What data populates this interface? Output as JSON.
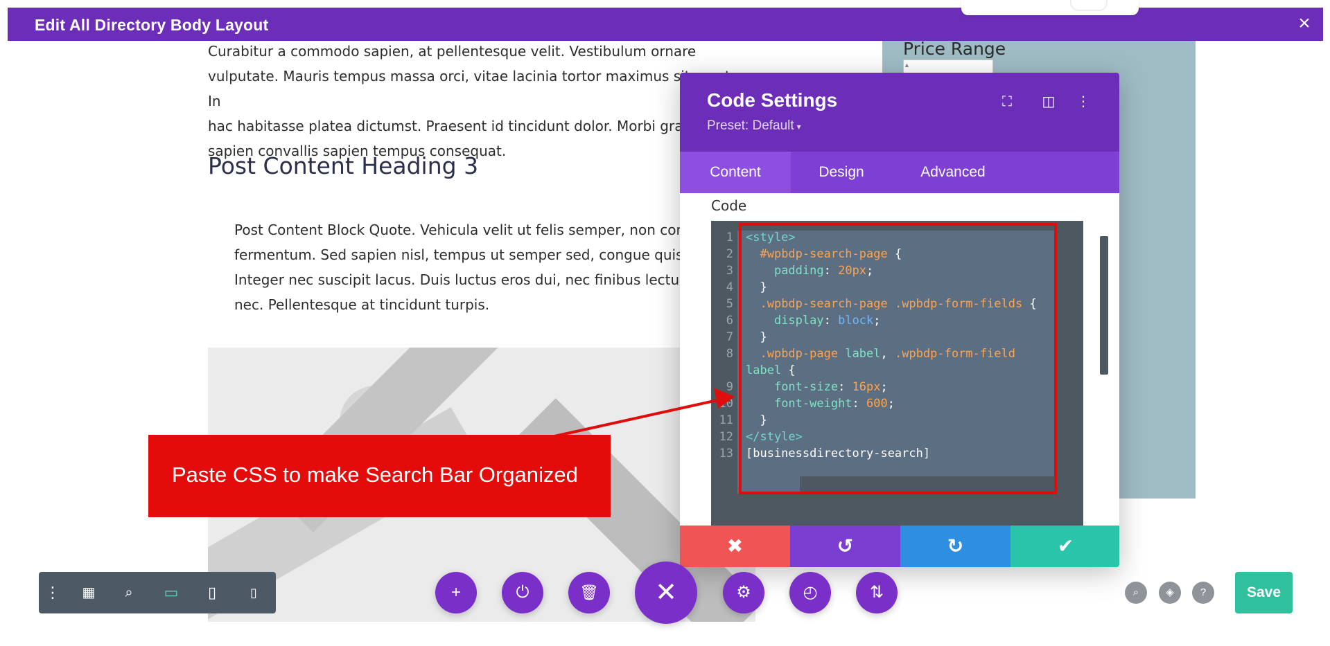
{
  "window": {
    "title": "Edit All Directory Body Layout",
    "close_icon": "×"
  },
  "page": {
    "paragraph": "Curabitur a commodo sapien, at pellentesque velit. Vestibulum ornare vulputate. Mauris tempus massa orci, vitae lacinia tortor maximus sit amet. In hac habitasse platea dictumst. Praesent id tincidunt dolor. Morbi gravida sapien convallis sapien tempus consequat.",
    "paragraph_lines": [
      "Curabitur a commodo sapien, at pellentesque velit. Vestibulum ornare",
      "vulputate. Mauris tempus massa orci, vitae lacinia tortor maximus sit amet. In",
      "hac habitasse platea dictumst. Praesent id tincidunt dolor. Morbi gra",
      "sapien convallis sapien tempus consequat."
    ],
    "heading": "Post Content Heading 3",
    "quote_lines": [
      "Post Content Block Quote. Vehicula velit ut felis semper, non con",
      "fermentum. Sed sapien nisl, tempus ut semper sed, congue quis",
      "Integer nec suscipit lacus. Duis luctus eros dui, nec finibus lectus",
      "nec. Pellentesque at tincidunt turpis."
    ]
  },
  "sidebar": {
    "price_range_label": "Price Range"
  },
  "modal": {
    "title": "Code Settings",
    "preset": "Preset: Default",
    "preset_caret": "▾",
    "icons": {
      "fullscreen": "⛶",
      "split": "◫",
      "more": "⋮"
    },
    "tabs": [
      {
        "label": "Content",
        "active": true
      },
      {
        "label": "Design",
        "active": false
      },
      {
        "label": "Advanced",
        "active": false
      }
    ],
    "code_label": "Code",
    "code_lines": [
      {
        "n": "1",
        "text": "<style>"
      },
      {
        "n": "2",
        "text": "  #wpbdp-search-page {"
      },
      {
        "n": "3",
        "text": "    padding: 20px;"
      },
      {
        "n": "4",
        "text": "  }"
      },
      {
        "n": "5",
        "text": "  .wpbdp-search-page .wpbdp-form-fields {"
      },
      {
        "n": "6",
        "text": "    display: block;"
      },
      {
        "n": "7",
        "text": "  }"
      },
      {
        "n": "8",
        "text": "  .wpbdp-page label, .wpbdp-form-field"
      },
      {
        "n": "",
        "text": "label {"
      },
      {
        "n": "9",
        "text": "    font-size: 16px;"
      },
      {
        "n": "10",
        "text": "    font-weight: 600;"
      },
      {
        "n": "11",
        "text": "  }"
      },
      {
        "n": "12",
        "text": "</style>"
      },
      {
        "n": "13",
        "text": "[businessdirectory-search]"
      }
    ],
    "footer": {
      "cancel": "✖",
      "undo": "↺",
      "redo": "↻",
      "save": "✔"
    },
    "colors": {
      "header": "#6c2eb9",
      "tabs": "#7d3fd4",
      "cancel": "#ef5555",
      "undo": "#7c3dd1",
      "redo": "#2e8fe0",
      "save": "#29c4a9"
    }
  },
  "annotation": {
    "text": "Paste CSS to make Search Bar Organized",
    "color": "#e40b0b"
  },
  "toolbar": {
    "left_icons": [
      "more-vertical-icon",
      "layout-icon",
      "zoom-icon",
      "desktop-icon",
      "tablet-icon",
      "phone-icon"
    ],
    "fab_icons": [
      "add-icon",
      "power-icon",
      "trash-icon",
      "close-icon",
      "gear-icon",
      "history-icon",
      "sort-icon"
    ],
    "right_icons": [
      "search-icon",
      "layers-icon",
      "help-icon"
    ],
    "save_label": "Save",
    "help_glyph": "?"
  }
}
